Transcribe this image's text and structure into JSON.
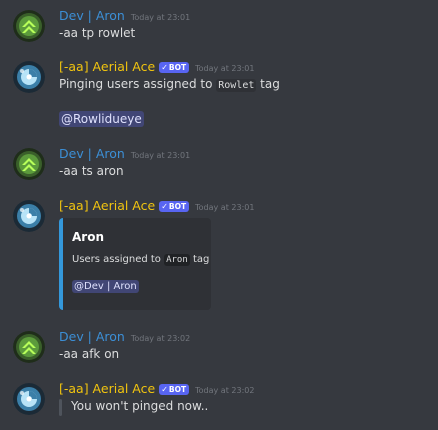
{
  "users": {
    "dev": {
      "name": "Dev | Aron",
      "color": "#3c8fd6",
      "avatar_icon": "green-chevron-emblem-icon"
    },
    "bot": {
      "name": "[-aa] Aerial Ace",
      "color": "#f1c40f",
      "bot_tag": "BOT",
      "bot_check": "✓",
      "avatar_icon": "blue-spiral-emblem-icon"
    }
  },
  "messages": [
    {
      "author": "dev",
      "timestamp": "Today at 23:01",
      "text": "-aa tp rowlet"
    },
    {
      "author": "bot",
      "timestamp": "Today at 23:01",
      "text_before": "Pinging users assigned to ",
      "code": "Rowlet",
      "text_after": " tag",
      "mention": "@Rowlidueye"
    },
    {
      "author": "dev",
      "timestamp": "Today at 23:01",
      "text": "-aa ts aron"
    },
    {
      "author": "bot",
      "timestamp": "Today at 23:01",
      "embed": {
        "title": "Aron",
        "desc_before": "Users assigned to ",
        "code": "Aron",
        "desc_after": " tag",
        "mention": "@Dev | Aron",
        "color": "#3498db"
      }
    },
    {
      "author": "dev",
      "timestamp": "Today at 23:02",
      "text": "-aa afk on"
    },
    {
      "author": "bot",
      "timestamp": "Today at 23:02",
      "quote": "You won't pinged now.."
    }
  ],
  "colors": {
    "background": "#36393f",
    "mention_bg": "#414675",
    "bot_tag_bg": "#5865f2",
    "timestamp": "#72767d"
  }
}
